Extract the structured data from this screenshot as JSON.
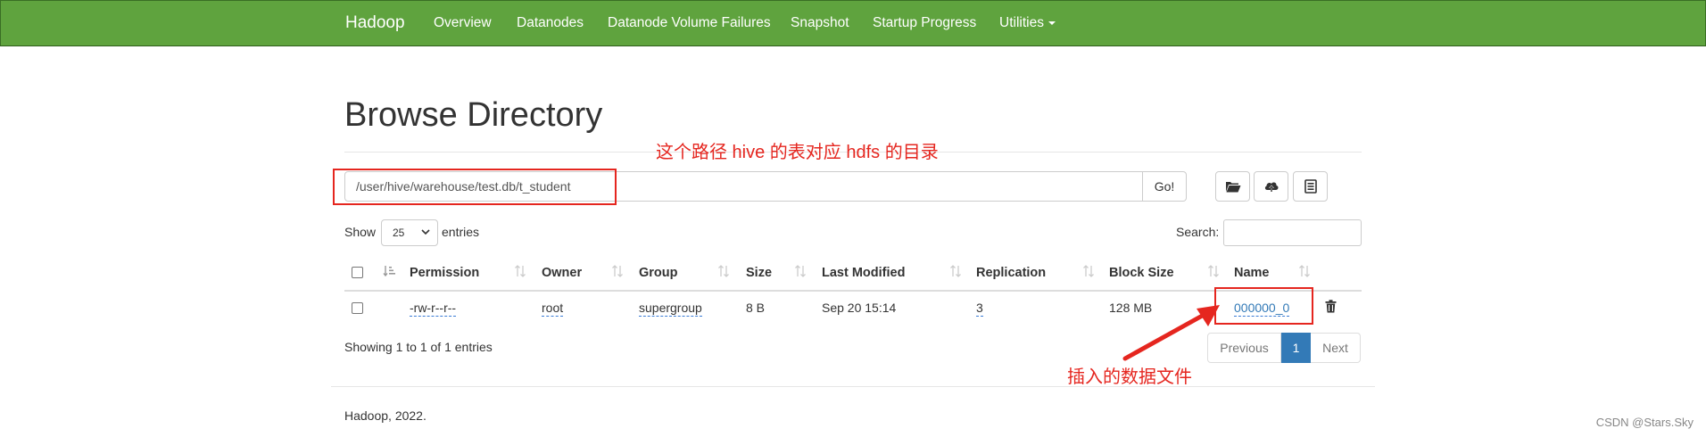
{
  "navbar": {
    "brand": "Hadoop",
    "items": [
      "Overview",
      "Datanodes",
      "Datanode Volume Failures",
      "Snapshot",
      "Startup Progress",
      "Utilities"
    ]
  },
  "page": {
    "title": "Browse Directory",
    "path_value": "/user/hive/warehouse/test.db/t_student",
    "go_label": "Go!"
  },
  "annotations": {
    "path_note": "这个路径 hive 的表对应 hdfs 的目录",
    "file_note": "插入的数据文件"
  },
  "table_controls": {
    "show_label": "Show",
    "page_length": "25",
    "entries_label": "entries",
    "search_label": "Search:",
    "search_value": ""
  },
  "table": {
    "columns": [
      "Permission",
      "Owner",
      "Group",
      "Size",
      "Last Modified",
      "Replication",
      "Block Size",
      "Name"
    ],
    "rows": [
      {
        "permission": "-rw-r--r--",
        "owner": "root",
        "group": "supergroup",
        "size": "8 B",
        "last_modified": "Sep 20 15:14",
        "replication": "3",
        "block_size": "128 MB",
        "name": "000000_0"
      }
    ]
  },
  "table_info": "Showing 1 to 1 of 1 entries",
  "pagination": {
    "previous": "Previous",
    "current": "1",
    "next": "Next"
  },
  "footer": "Hadoop, 2022.",
  "watermark": "CSDN @Stars.Sky",
  "colors": {
    "navbar": "#5fa33e",
    "annotation": "#e5261f",
    "link": "#337ab7",
    "pager_active": "#337ab7"
  },
  "icons": [
    "folder-open-icon",
    "cloud-upload-icon",
    "list-icon",
    "sort-icon",
    "trash-icon",
    "chevron-down-icon",
    "arrow-annotation"
  ]
}
